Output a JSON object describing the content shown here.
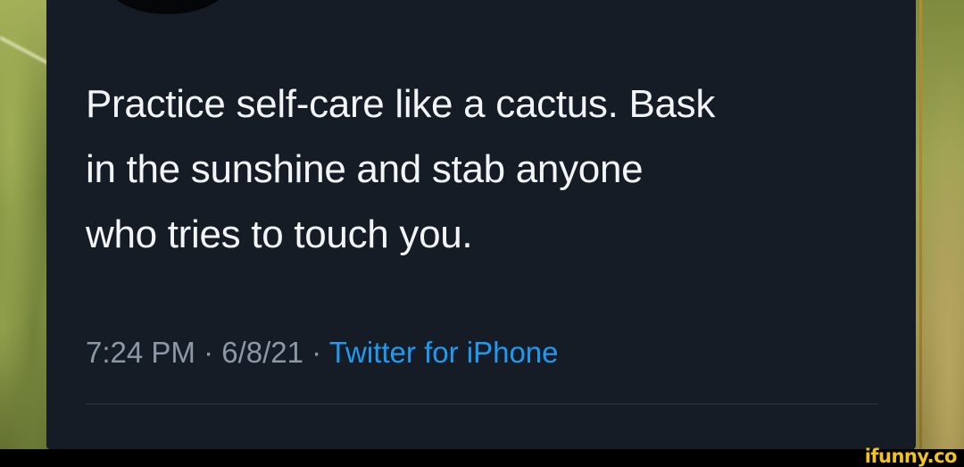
{
  "tweet": {
    "text": "Practice self-care like a cactus. Bask\nin the sunshine and stab anyone\nwho tries to touch you.",
    "time": "7:24 PM",
    "separator": " · ",
    "date": "6/8/21",
    "source": "Twitter for iPhone"
  },
  "watermark": {
    "text": "ifunny.co"
  },
  "colors": {
    "card_background": "#161c26",
    "text_primary": "#f2f4f6",
    "text_secondary": "#8b98a5",
    "link_blue": "#1d9bf0",
    "watermark_yellow": "#f3c41e"
  }
}
